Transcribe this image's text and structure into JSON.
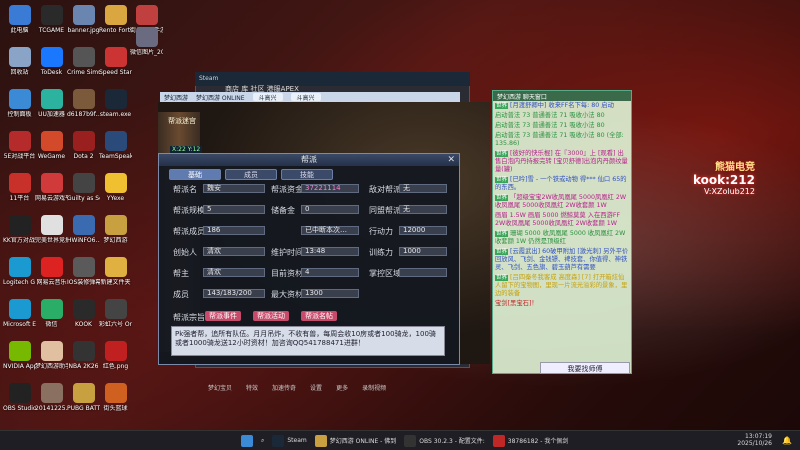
{
  "desktop_icons": [
    {
      "label": "此电脑",
      "color": "#3a7bd5",
      "col": 0,
      "row": 0
    },
    {
      "label": "TCGAME",
      "color": "#2a2a2a",
      "col": 1,
      "row": 0
    },
    {
      "label": "banner.jpg",
      "color": "#6a86b0",
      "col": 2,
      "row": 0
    },
    {
      "label": "Rento Fortune -...",
      "color": "#d9a640",
      "col": 3,
      "row": 0
    },
    {
      "label": "回收站",
      "color": "#8aa4c8",
      "col": 0,
      "row": 1
    },
    {
      "label": "ToDesk",
      "color": "#1a78ff",
      "col": 1,
      "row": 1
    },
    {
      "label": "Crime Simulator",
      "color": "#555",
      "col": 2,
      "row": 1
    },
    {
      "label": "Speed Stars",
      "color": "#c33",
      "col": 3,
      "row": 1
    },
    {
      "label": "控制面板",
      "color": "#3a8ad5",
      "col": 0,
      "row": 2
    },
    {
      "label": "UU加速器",
      "color": "#2bb3a0",
      "col": 1,
      "row": 2
    },
    {
      "label": "d6187b9f...",
      "color": "#7a5a3a",
      "col": 2,
      "row": 2
    },
    {
      "label": "steam.exe",
      "color": "#1b2838",
      "col": 3,
      "row": 2
    },
    {
      "label": "5E对战平台",
      "color": "#b52a2a",
      "col": 0,
      "row": 3
    },
    {
      "label": "WeGame",
      "color": "#d24a2a",
      "col": 1,
      "row": 3
    },
    {
      "label": "Dota 2",
      "color": "#9a2020",
      "col": 2,
      "row": 3
    },
    {
      "label": "TeamSpeak...",
      "color": "#2a4a7a",
      "col": 3,
      "row": 3
    },
    {
      "label": "11平台",
      "color": "#c8302a",
      "col": 0,
      "row": 4
    },
    {
      "label": "网易云游戏平台",
      "color": "#d03a3a",
      "col": 1,
      "row": 4
    },
    {
      "label": "Guilty as Sock!",
      "color": "#444",
      "col": 2,
      "row": 4
    },
    {
      "label": "YYexe",
      "color": "#f0c030",
      "col": 3,
      "row": 4
    },
    {
      "label": "KK官方对战平台",
      "color": "#222",
      "col": 0,
      "row": 5
    },
    {
      "label": "完美世界竞技平台",
      "color": "#e0e0e0",
      "col": 1,
      "row": 5
    },
    {
      "label": "HWiNFO6...",
      "color": "#3a6ab0",
      "col": 2,
      "row": 5
    },
    {
      "label": "梦幻西游",
      "color": "#c8a040",
      "col": 3,
      "row": 5
    },
    {
      "label": "Logitech G HUB",
      "color": "#1a9ad0",
      "col": 0,
      "row": 6
    },
    {
      "label": "网易云音乐",
      "color": "#d22",
      "col": 1,
      "row": 6
    },
    {
      "label": "IOS装修弹幕.jpg",
      "color": "#5a5a5a",
      "col": 2,
      "row": 6
    },
    {
      "label": "新建文件夹",
      "color": "#e0b040",
      "col": 3,
      "row": 6
    },
    {
      "label": "Microsoft Edge",
      "color": "#1a9ad0",
      "col": 0,
      "row": 7
    },
    {
      "label": "微信",
      "color": "#2aae67",
      "col": 1,
      "row": 7
    },
    {
      "label": "KOOK",
      "color": "#2a2a2a",
      "col": 2,
      "row": 7
    },
    {
      "label": "彩虹六号 Online",
      "color": "#444",
      "col": 3,
      "row": 7
    },
    {
      "label": "NVIDIA App",
      "color": "#76b900",
      "col": 0,
      "row": 8
    },
    {
      "label": "梦幻西游助手",
      "color": "#e0c0a0",
      "col": 1,
      "row": 8
    },
    {
      "label": "NBA 2K26",
      "color": "#333",
      "col": 2,
      "row": 8
    },
    {
      "label": "红色.png",
      "color": "#c02020",
      "col": 3,
      "row": 8
    },
    {
      "label": "OBS Studio",
      "color": "#222",
      "col": 0,
      "row": 9
    },
    {
      "label": "20141225...",
      "color": "#8a7060",
      "col": 1,
      "row": 9
    },
    {
      "label": "PUBG BATTLEGR...",
      "color": "#c8a040",
      "col": 2,
      "row": 9
    },
    {
      "label": "街头篮球",
      "color": "#d06020",
      "col": 3,
      "row": 9
    }
  ],
  "desktop_icons_col4": [
    {
      "label": "街头篮球手游",
      "color": "#c04040",
      "row": 0
    },
    {
      "label": "微信图片_2025071...",
      "color": "#6a6a80",
      "row": 0.55
    }
  ],
  "steam": {
    "title": "Steam",
    "menu": "商店  库  社区  港服APEX"
  },
  "game": {
    "title_left": "梦幻西游",
    "title_mid": "梦幻西游 ONLINE",
    "tab1": "斗高兴",
    "tab2": "斗高兴",
    "char_top": "帮派迷宫",
    "coords": "X:22 Y:12"
  },
  "guild": {
    "title": "帮派",
    "tabs": [
      "基础",
      "成员",
      "技能"
    ],
    "rows": [
      {
        "l": "帮派名",
        "v": "魏安",
        "l2": "帮派资金",
        "v2": "37221114",
        "l3": "敌对帮派",
        "v3": "无"
      },
      {
        "l": "帮派规模",
        "v": "5",
        "l2": "储备金",
        "v2": "0",
        "l3": "同盟帮派",
        "v3": "无"
      },
      {
        "l": "帮派成员",
        "v": "186",
        "l2": "",
        "v2": "已中断本次…",
        "l3": "行动力",
        "v3": "12000"
      },
      {
        "l": "创始人",
        "v": "清欢",
        "l2": "维护时间",
        "v2": "13:48",
        "l3": "训练力",
        "v3": "1000"
      },
      {
        "l": "帮主",
        "v": "清欢",
        "l2": "目前资材",
        "v2": "4",
        "l3": "掌控区域",
        "v3": ""
      },
      {
        "l": "成员",
        "v": "143/183/200",
        "l2": "最大资材",
        "v2": "1300",
        "l3": "",
        "v3": ""
      }
    ],
    "zongzhi": "帮派宗旨",
    "notice": "Pk强者帮，追所有队伍。月月吊炸，不收有兽，每周会收10房或者100骑龙，100骑或者1000骑龙送12小时资材！加咨询QQ541788471进群！",
    "buttons": [
      "帮派事件",
      "帮派活动",
      "帮派名帖"
    ]
  },
  "chat": {
    "title": "梦幻西游 聊天窗口",
    "lines": [
      {
        "t": "世界",
        "c": "b",
        "x": "[月渡舒卿中] 收来FF名下每: 80 启动"
      },
      {
        "t": "",
        "c": "g",
        "x": "启动普法 73 普通善法 71 吸收小法 80"
      },
      {
        "t": "",
        "c": "g",
        "x": "启动普法 73 普通善法 71 吸收小法 80"
      },
      {
        "t": "",
        "c": "g",
        "x": "启动普法 73 普通善法 71 吸收小法 80 (全部: 135.86)"
      },
      {
        "t": "世界",
        "c": "",
        "x": "[彼好的快乐棍] 在『3000』上 [观看] 出售白泡内丹持报完转 [宝贝舒德]出泡内丹颜纹量量(罐)"
      },
      {
        "t": "世界",
        "c": "b",
        "x": "[已吟]雪 - 一个铁或动物 得*** 仙口 65的 的东西。"
      },
      {
        "t": "世界",
        "c": "",
        "x": "「超级宝宝2W收凤凰尾 5000凤凰红 2W收凤凰尾 5000收凤凰红 2W收套颜 1W"
      },
      {
        "t": "",
        "c": "",
        "x": "画眉 1.5W 画眉 5000 燃鲸莫莫 入在西游FF 2W收凤凰尾 5000收凤凰红 2W收套颜 1W"
      },
      {
        "t": "世界",
        "c": "g",
        "x": "珊瑚 5000 收凤凰尾 5000 收凤凰红 2W 收套颜 1W 仍然是顶级红"
      },
      {
        "t": "世界",
        "c": "b",
        "x": "[云霞武出] 60破甲附加 [激光刺] 另外平价回放风、飞剑、金钱镖、裨技套、你值得、神铁灵、飞剑、五色旗、碧玉葫芦有需要"
      },
      {
        "t": "世界",
        "c": "y",
        "x": "[吕四秦冬我客成 高度森] [7] 打开箱炫仙人留下的宝物图，里现一片流光溢彩的景象，里边的装备"
      },
      {
        "t": "",
        "c": "r",
        "x": "宝剑[黑宝石]！"
      }
    ],
    "send": "我要找师傅"
  },
  "bottom_bar": [
    "梦幻宝贝",
    "特效",
    "加速传奇",
    "设置",
    "更多",
    "录制视频"
  ],
  "brand": {
    "line1": "熊猫电竞",
    "line2": "kook:212",
    "line3": "V:XZolub212"
  },
  "taskbar": {
    "items": [
      "Steam",
      "梦幻西游 ONLINE - 佛到",
      "OBS 30.2.3 - 配置文件: ",
      "38786182 - 我个佩剑"
    ],
    "time": "13:07:19",
    "date": "2025/10/26"
  }
}
